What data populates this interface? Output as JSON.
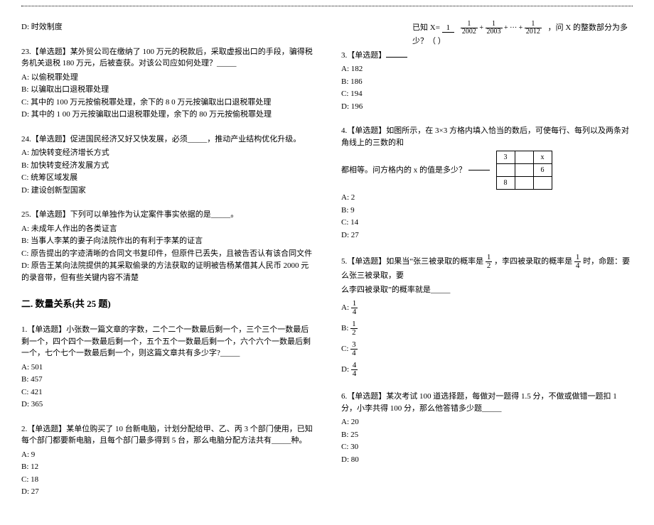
{
  "col1": {
    "q22_opt_d": "D: 时效制度",
    "q23": {
      "stem": "23.【单选题】某外贸公司在缴纳了 100 万元的税款后，采取虚报出口的手段，骗得税务机关退税 180 万元，后被查获。对该公司应如何处理？_____",
      "a": "A: 以偷税罪处理",
      "b": "B: 以骗取出口退税罪处理",
      "c": "C: 其中的 100 万元按偷税罪处理，余下的 8 0 万元按骗取出口退税罪处理",
      "d": "D: 其中的 1 00 万元按骗取出口退税罪处理，余下的 80 万元按偷税罪处理"
    },
    "q24": {
      "stem": "24.【单选题】促进国民经济又好又快发展，必须_____，推动产业结构优化升级。",
      "a": "A: 加快转变经济增长方式",
      "b": "B: 加快转变经济发展方式",
      "c": "C: 统筹区域发展",
      "d": "D: 建设创新型国家"
    },
    "q25": {
      "stem": "25.【单选题】下列可以单独作为认定案件事实依据的是_____。",
      "a": "A: 未成年人作出的各类证言",
      "b": "B: 当事人李某的妻子向法院作出的有利于李某的证言",
      "c": "C: 原告提出的字迹清晰的合同文书复印件，但原件已丢失，且被告否认有该合同文件",
      "d": "D: 原告王某向法院提供的其采取偷录的方法获取的证明被告杨某借其人民币 2000 元的录音带，但有些关键内容不清楚"
    },
    "section2": "二. 数量关系(共 25 题)",
    "q1": {
      "stem": "1.【单选题】小张数一篇文章的字数，二个二个一数最后剩一个，三个三个一数最后剩一个，四个四个一数最后剩一个，五个五个一数最后剩一个，六个六个一数最后剩一个，七个七个一数最后剩一个，则这篇文章共有多少字?_____",
      "a": "A: 501",
      "b": "B: 457",
      "c": "C: 421",
      "d": "D: 365"
    },
    "q2": {
      "stem_a": "2.【单选题】某单位购买了 10 台新电脑，计划分配给甲、乙、丙 3 个部门使用，已知每个部门都要新电脑，且每个部门最多得到 5 台，那么电脑分配方法共有_____种。",
      "a": "A: 9",
      "b": "B: 12",
      "c": "C: 18",
      "d": "D: 27"
    }
  },
  "col2": {
    "q3": {
      "pre": "已知 X=",
      "post": "，问 X 的整数部分为多少？（ ）",
      "stem": "3.【单选题】",
      "frac_top": "1",
      "d1n": "1",
      "d1d": "2002",
      "d2n": "1",
      "d2d": "2003",
      "d3n": "1",
      "d3d": "2012",
      "a": "A: 182",
      "b": "B: 186",
      "c": "C: 194",
      "d": "D: 196"
    },
    "q4": {
      "stem_a": "4.【单选题】如图所示，在 3×3 方格内填入恰当的数后，可使每行、每列以及两条对角线上的三数的和",
      "stem_b": "都相等。问方格内的 x 的值是多少？",
      "g_00": "3",
      "g_02": "x",
      "g_12": "6",
      "g_20": "8",
      "a": "A: 2",
      "b": "B: 9",
      "c": "C: 14",
      "d": "D: 27"
    },
    "q5": {
      "stem_a": "5.【单选题】如果当“张三被录取的概率是",
      "f1n": "1",
      "f1d": "2",
      "stem_b": "，李四被录取的概率是",
      "f2n": "1",
      "f2d": "4",
      "stem_c": "时，命题：要么张三被录取，要",
      "stem_d": "么李四被录取”的概率就是_____",
      "an": "1",
      "ad": "4",
      "bn": "1",
      "bd": "2",
      "cn": "3",
      "cd": "4",
      "dn": "4",
      "dd": "4",
      "la": "A: ",
      "lb": "B: ",
      "lc": "C: ",
      "ld": "D: "
    },
    "q6": {
      "stem": "6.【单选题】某次考试 100 道选择题，每做对一题得 1.5 分，不做或做错一题扣 1 分，小李共得 100 分，那么他答错多少题_____",
      "a": "A: 20",
      "b": "B: 25",
      "c": "C: 30",
      "d": "D: 80"
    }
  }
}
